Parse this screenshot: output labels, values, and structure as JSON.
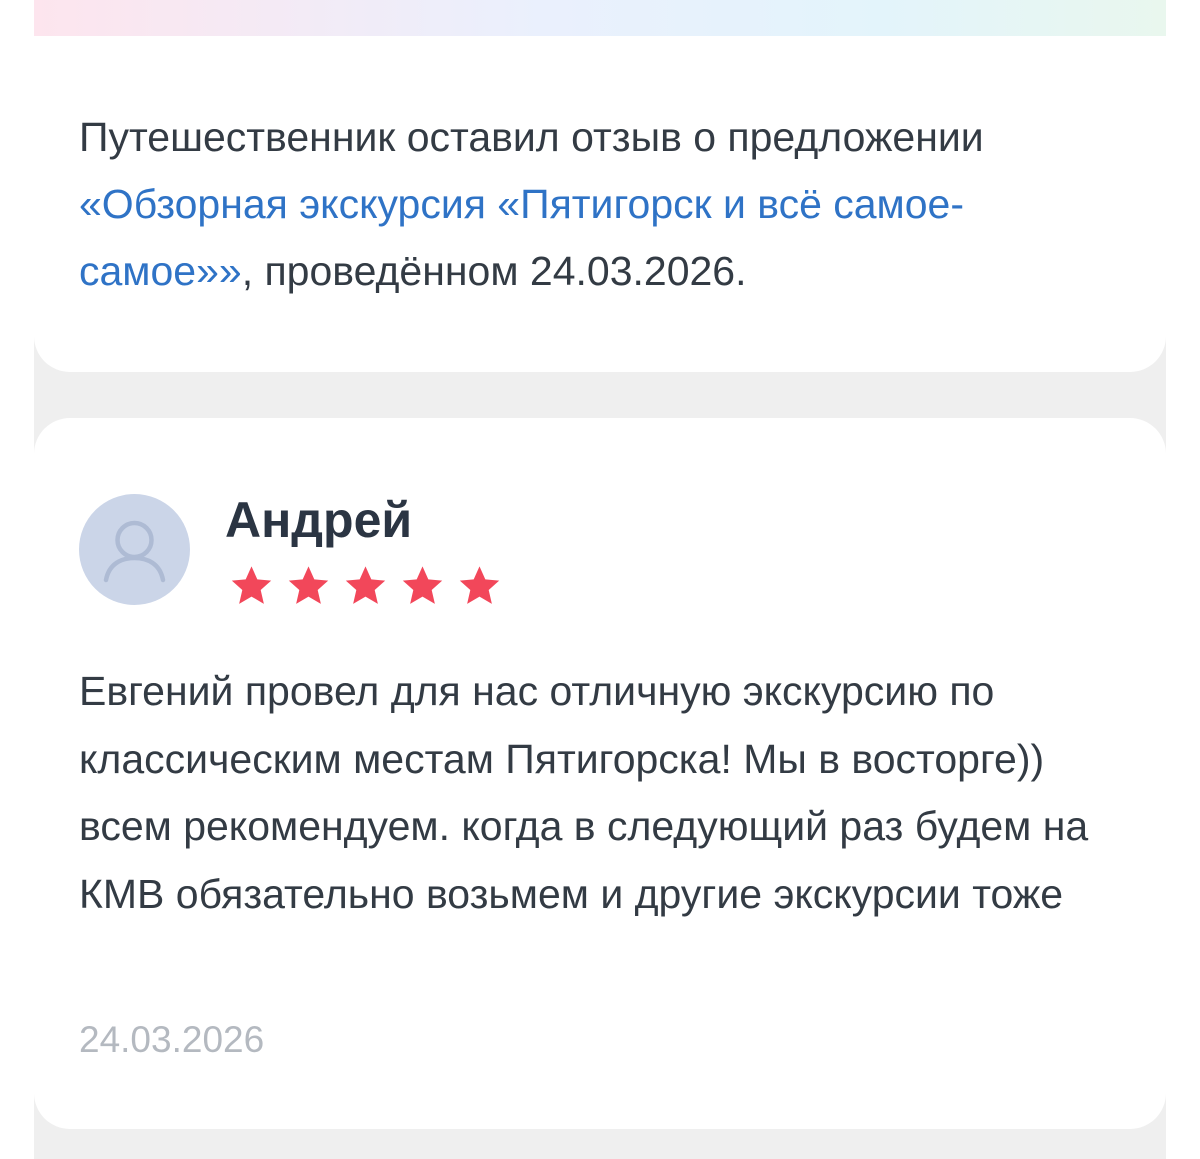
{
  "offer_notice": {
    "prefix": "Путешественник оставил отзыв о предложении ",
    "offer_title": "«Обзорная экскурсия «Пятигорск и всё самое-самое»»",
    "suffix": ", проведённом 24.03.2026."
  },
  "review": {
    "author": "Андрей",
    "avatar_icon": "user-silhouette-icon",
    "rating": 5,
    "rating_max": 5,
    "star_color": "#f2475a",
    "text": "Евгений провел для нас отличную экскурсию по классическим местам Пятигорска! Мы в восторге)) всем рекомендуем. когда в следующий раз будем на КМВ обязательно возьмем и другие экскурсии тоже",
    "date": "24.03.2026"
  }
}
